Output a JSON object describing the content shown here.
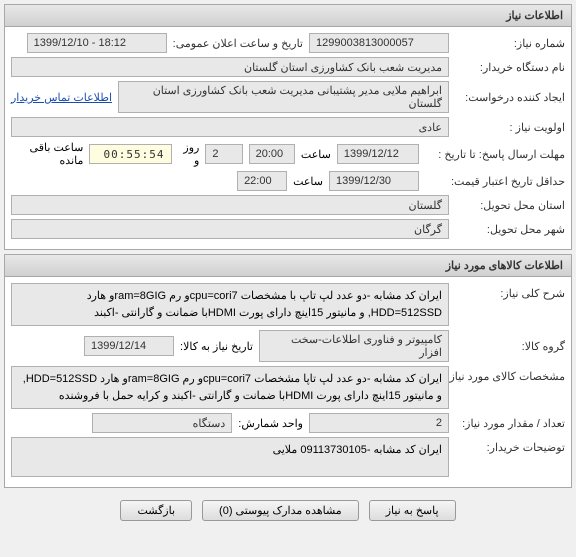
{
  "panel1": {
    "title": "اطلاعات نیاز",
    "requestNoLabel": "شماره نیاز:",
    "requestNo": "1299003813000057",
    "announceLabel": "تاریخ و ساعت اعلان عمومی:",
    "announceValue": "1399/12/10 - 18:12",
    "orgLabel": "نام دستگاه خریدار:",
    "orgValue": "مدیریت شعب بانک کشاورزی استان گلستان",
    "creatorLabel": "ایجاد کننده درخواست:",
    "creatorValue": "ابراهیم ملایی  مدیر پشتیبانی مدیریت شعب بانک کشاورزی استان گلستان",
    "contactLink": "اطلاعات تماس خریدار",
    "priorityLabel": "اولویت نیاز :",
    "priorityValue": "عادی",
    "deadlineLabel": "مهلت ارسال پاسخ:  تا تاریخ :",
    "deadlineDate": "1399/12/12",
    "timeLabel1": "ساعت",
    "deadlineTime": "20:00",
    "remainDays": "2",
    "dayLabel": "روز و",
    "remainTime": "00:55:54",
    "remainLabel": "ساعت باقی مانده",
    "creditLabel": "حداقل تاریخ اعتبار قیمت:",
    "creditDate": "1399/12/30",
    "timeLabel2": "ساعت",
    "creditTime": "22:00",
    "deliverLabel": "استان محل تحویل:",
    "deliverValue": "گلستان",
    "cityLabel": "شهر محل تحویل:",
    "cityValue": "گرگان"
  },
  "panel2": {
    "title": "اطلاعات کالاهای مورد نیاز",
    "descLabel": "شرح کلی نیاز:",
    "descValue": "ایران کد مشابه -دو عدد لپ تاپ با مشخصات cpu=cori7و رم ram=8GIGو هارد HDD=512SSD, و مانیتور 15اینچ دارای پورت HDMIبا ضمانت و گارانتی -اکبند",
    "groupLabel": "گروه کالا:",
    "groupValue": "کامپیوتر و فناوری اطلاعات-سخت افزار",
    "needDateLabel": "تاریخ نیاز به کالا:",
    "needDateValue": "1399/12/14",
    "specLabel": "مشخصات کالای مورد نیاز:",
    "specValue": "ایران کد مشابه -دو عدد لپ تاپا مشخصات cpu=cori7و رم ram=8GIGو هارد HDD=512SSD, و مانیتور 15اینچ دارای پورت HDMIبا ضمانت و گارانتی -اکبند و کرایه حمل با فروشنده",
    "qtyLabel": "تعداد / مقدار مورد نیاز:",
    "qtyValue": "2",
    "unitLabel": "واحد شمارش:",
    "unitValue": "دستگاه",
    "notesLabel": "توضیحات خریدار:",
    "notesValue": "ایران کد مشابه -09113730105 ملایی"
  },
  "buttons": {
    "reply": "پاسخ به نیاز",
    "attach": "مشاهده مدارک پیوستی (0)",
    "back": "بازگشت"
  }
}
